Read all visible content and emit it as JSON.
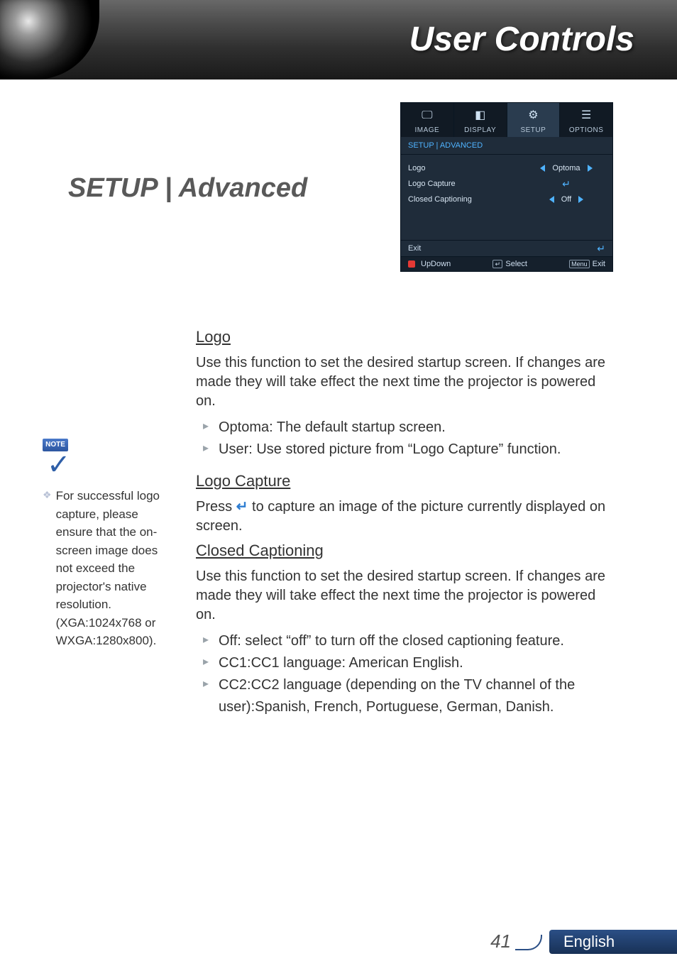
{
  "banner": {
    "title": "User Controls"
  },
  "section": {
    "title": "SETUP | Advanced"
  },
  "osd": {
    "tabs": [
      {
        "label": "IMAGE",
        "icon": "🖵",
        "name": "osd-tab-image"
      },
      {
        "label": "DISPLAY",
        "icon": "◧",
        "name": "osd-tab-display"
      },
      {
        "label": "SETUP",
        "icon": "⚙",
        "name": "osd-tab-setup",
        "active": true
      },
      {
        "label": "OPTIONS",
        "icon": "☰",
        "name": "osd-tab-options"
      }
    ],
    "breadcrumb": "SETUP | ADVANCED",
    "rows": {
      "logo": {
        "label": "Logo",
        "value": "Optoma",
        "type": "lr"
      },
      "logo_capture": {
        "label": "Logo Capture",
        "type": "enter"
      },
      "closed_caption": {
        "label": "Closed Captioning",
        "value": "Off",
        "type": "lr"
      }
    },
    "exit": {
      "label": "Exit"
    },
    "footer": {
      "updown": "UpDown",
      "select": "Select",
      "menu": "Menu",
      "exit": "Exit"
    }
  },
  "body": {
    "logo": {
      "heading": "Logo",
      "para": "Use this function to set the desired startup screen. If changes are made they will take effect the next time the projector is powered on.",
      "bullets": [
        "Optoma: The default startup screen.",
        "User: Use stored picture from “Logo Capture” function."
      ]
    },
    "logo_capture": {
      "heading": "Logo Capture",
      "pre": "Press ",
      "post": " to capture an image of the picture currently displayed on screen.",
      "enter_glyph": "↵"
    },
    "cc": {
      "heading": "Closed Captioning",
      "para": "Use this function to set the desired startup screen. If changes are made they will take effect the next time the projector is powered on.",
      "bullets": [
        "Off: select “off” to turn off the closed captioning feature.",
        "CC1:CC1 language: American English.",
        "CC2:CC2 language (depending on the TV channel of the user):Spanish, French, Portuguese, German, Danish."
      ]
    }
  },
  "note": {
    "badge": "NOTE",
    "text": "For successful logo capture, please ensure that the on-screen image does not exceed the projector's native resolution. (XGA:1024x768 or WXGA:1280x800)."
  },
  "footer": {
    "page": "41",
    "lang": "English"
  }
}
